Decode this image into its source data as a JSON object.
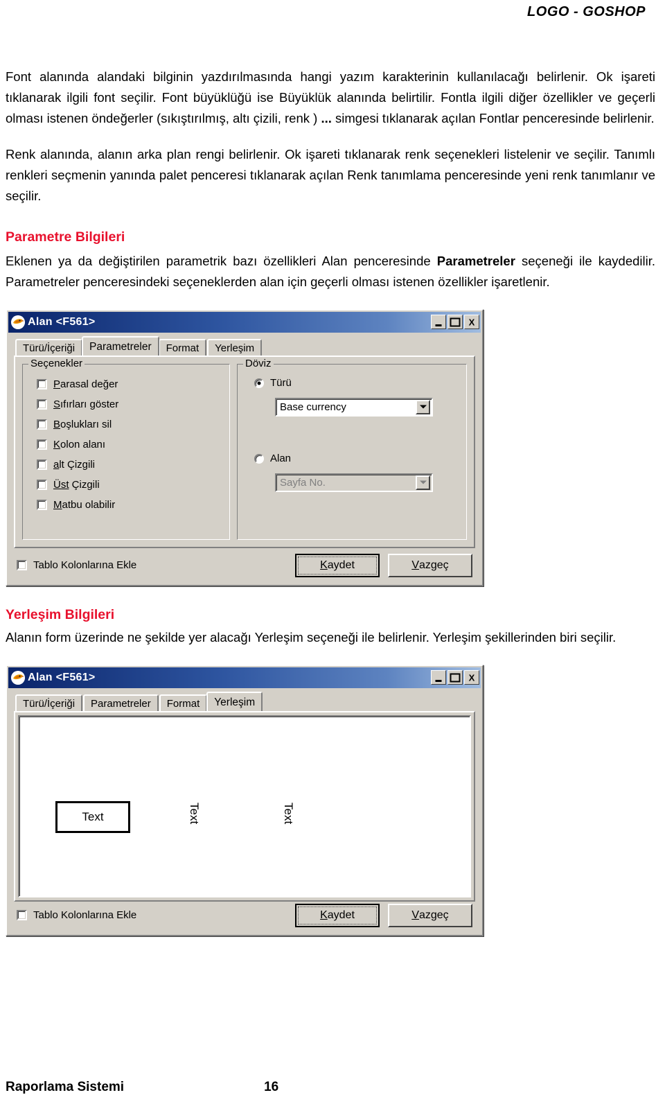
{
  "document": {
    "header_logo": "LOGO - GOSHOP",
    "paragraphs": {
      "p1_a": "Font alanında alandaki bilginin yazdırılmasında hangi yazım karakterinin kullanılacağı belirlenir. Ok işareti tıklanarak ilgili font seçilir. Font büyüklüğü ise Büyüklük alanında belirtilir. Fontla ilgili diğer özellikler ve geçerli olması istenen öndeğerler (sıkıştırılmış, altı çizili, renk ) ",
      "p1_bold": "...",
      "p1_b": " simgesi tıklanarak açılan Fontlar penceresinde belirlenir.",
      "p2": "Renk alanında, alanın arka plan rengi belirlenir. Ok işareti tıklanarak renk seçenekleri listelenir ve seçilir. Tanımlı renkleri seçmenin yanında palet penceresi tıklanarak açılan Renk tanımlama penceresinde yeni renk tanımlanır ve seçilir.",
      "p3_a": "Eklenen ya da değiştirilen parametrik bazı özellikleri Alan penceresinde ",
      "p3_bold": "Parametreler",
      "p3_b": " seçeneği ile kaydedilir. Parametreler penceresindeki seçeneklerden alan için geçerli olması istenen özellikler işaretlenir.",
      "p4": "Alanın form üzerinde ne şekilde yer alacağı Yerleşim seçeneği ile belirlenir. Yerleşim şekillerinden biri seçilir."
    },
    "headings": {
      "parametre": "Parametre Bilgileri",
      "yerlesim": "Yerleşim Bilgileri"
    },
    "heading_color": "#e8112d",
    "footer": {
      "left": "Raporlama Sistemi",
      "page": "16"
    }
  },
  "dialog_parametreler": {
    "title": "Alan <F561>",
    "window_buttons": {
      "minimize": "_",
      "maximize": "□",
      "close": "X"
    },
    "tabs": [
      {
        "label": "Türü/İçeriği",
        "active": false
      },
      {
        "label": "Parametreler",
        "active": true
      },
      {
        "label": "Format",
        "active": false
      },
      {
        "label": "Yerleşim",
        "active": false
      }
    ],
    "group_secenekler": {
      "legend": "Seçenekler",
      "checkboxes": [
        {
          "mnemonic": "P",
          "rest": "arasal değer",
          "checked": false
        },
        {
          "mnemonic": "S",
          "rest": "ıfırları göster",
          "checked": false
        },
        {
          "mnemonic": "B",
          "rest": "oşlukları sil",
          "checked": false
        },
        {
          "mnemonic": "K",
          "rest": "olon alanı",
          "checked": false
        },
        {
          "mnemonic": "a",
          "rest": "lt Çizgili",
          "checked": false
        },
        {
          "mnemonic": "Üst",
          "rest": " Çizgili",
          "checked": false
        },
        {
          "mnemonic": "M",
          "rest": "atbu olabilir",
          "checked": false
        }
      ]
    },
    "group_doviz": {
      "legend": "Döviz",
      "radio_turu": {
        "label": "Türü",
        "selected": true
      },
      "combo_turu": {
        "value": "Base currency",
        "disabled": false
      },
      "radio_alan": {
        "label": "Alan",
        "selected": false
      },
      "combo_alan": {
        "value": "Sayfa No.",
        "disabled": true
      }
    },
    "footer": {
      "checkbox_label": "Tablo Kolonlarına Ekle",
      "checkbox_checked": false,
      "save_mnemonic": "K",
      "save_rest": "aydet",
      "cancel_mnemonic": "V",
      "cancel_rest": "azgeç"
    }
  },
  "dialog_yerlesim": {
    "title": "Alan <F561>",
    "window_buttons": {
      "minimize": "_",
      "maximize": "□",
      "close": "X"
    },
    "tabs": [
      {
        "label": "Türü/İçeriği",
        "active": false
      },
      {
        "label": "Parametreler",
        "active": false
      },
      {
        "label": "Format",
        "active": false
      },
      {
        "label": "Yerleşim",
        "active": true
      }
    ],
    "canvas": {
      "sample_boxed": "Text",
      "sample_rotated_1": "Text",
      "sample_rotated_2": "Text"
    },
    "footer": {
      "checkbox_label": "Tablo Kolonlarına Ekle",
      "checkbox_checked": false,
      "save_mnemonic": "K",
      "save_rest": "aydet",
      "cancel_mnemonic": "V",
      "cancel_rest": "azgeç"
    }
  }
}
